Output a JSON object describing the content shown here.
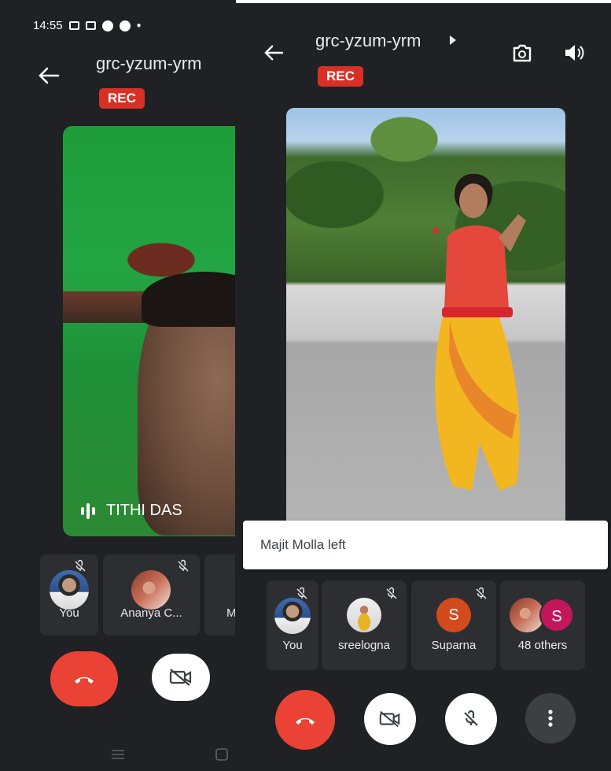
{
  "left": {
    "status_time": "14:55",
    "title": "grc-yzum-yrm",
    "rec_label": "REC",
    "speaker_name": "TITHI DAS",
    "participants": [
      {
        "label": "You"
      },
      {
        "label": "Ananya C..."
      },
      {
        "label": "M"
      }
    ]
  },
  "right": {
    "title": "grc-yzum-yrm",
    "rec_label": "REC",
    "toast": "Majit Molla left",
    "participants": [
      {
        "label": "You"
      },
      {
        "label": "sreelogna"
      },
      {
        "label": "Suparna",
        "initial": "S"
      },
      {
        "label": "48 others",
        "initial": "S"
      }
    ]
  },
  "colors": {
    "background": "#202124",
    "tile": "#2d2e31",
    "rec": "#d93025",
    "end_call": "#ea4335"
  },
  "icons": [
    "camera-icon",
    "message-icon",
    "jio-icon",
    "whatsapp-icon",
    "back-arrow-icon",
    "chevron-right-icon",
    "switch-camera-icon",
    "speaker-icon",
    "mic-off-icon",
    "end-call-icon",
    "video-off-icon",
    "more-vert-icon",
    "menu-nav-icon",
    "home-nav-icon"
  ]
}
